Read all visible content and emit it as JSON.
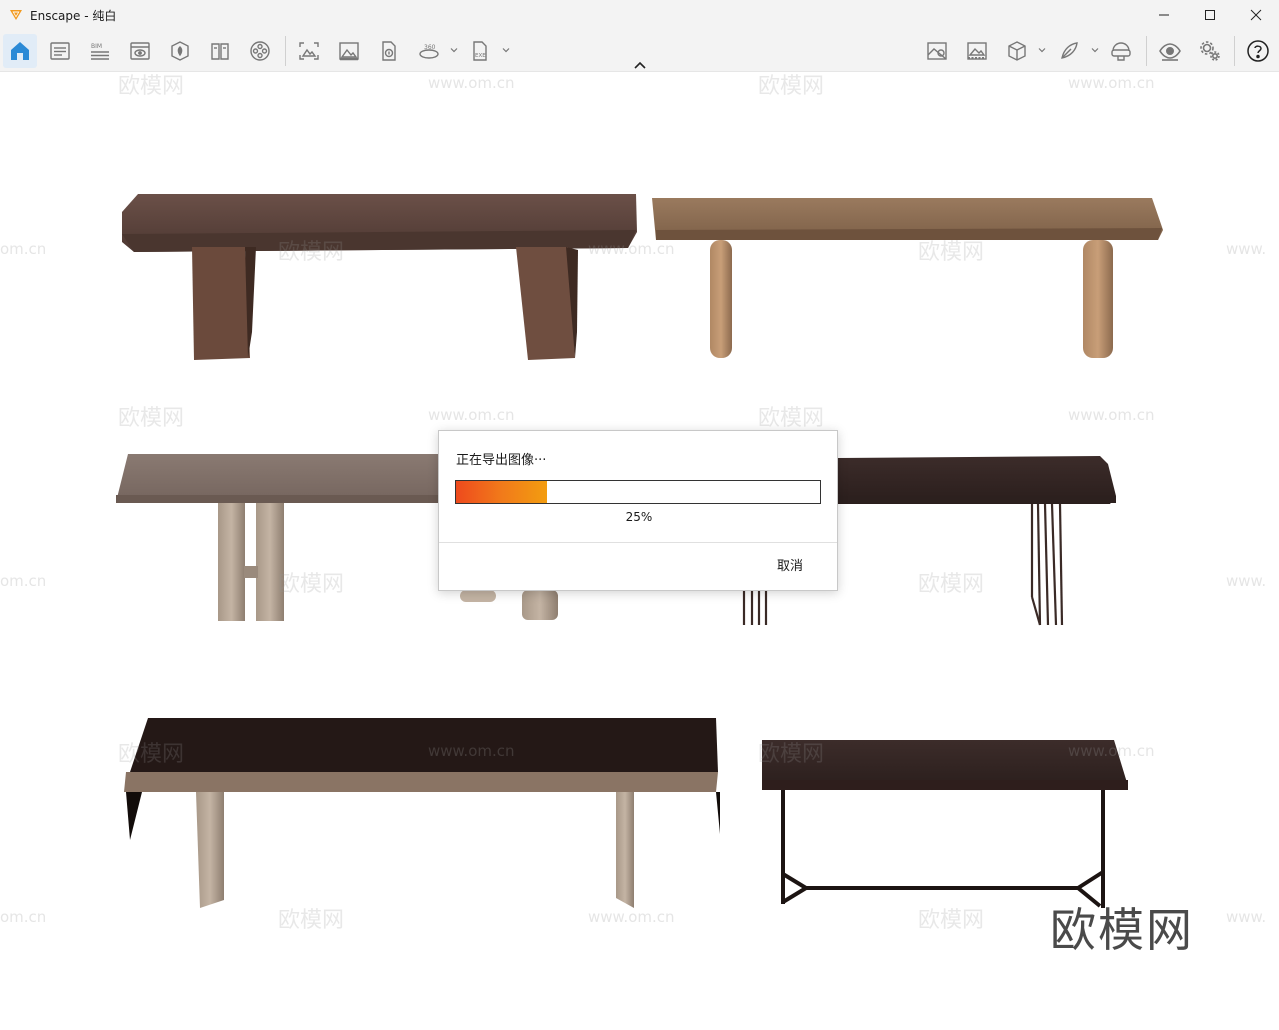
{
  "window": {
    "title": "Enscape - 纯白"
  },
  "toolbar": {
    "left_icons": [
      {
        "name": "home-icon",
        "active": true
      },
      {
        "name": "settings-list-icon"
      },
      {
        "name": "bim-icon",
        "label": "BIM"
      },
      {
        "name": "view-icon"
      },
      {
        "name": "asset-library-icon"
      },
      {
        "name": "material-book-icon"
      },
      {
        "name": "video-reel-icon"
      },
      {
        "name": "screenshot-icon"
      },
      {
        "name": "image-icon"
      },
      {
        "name": "upload-icon"
      },
      {
        "name": "panorama-360-icon",
        "label": "360"
      },
      {
        "name": "exe-export-icon",
        "label": "EXE"
      }
    ],
    "right_icons": [
      {
        "name": "map-icon"
      },
      {
        "name": "render-gallery-icon"
      },
      {
        "name": "cube-icon"
      },
      {
        "name": "feather-icon"
      },
      {
        "name": "vr-headset-icon"
      },
      {
        "name": "eye-icon"
      },
      {
        "name": "gears-icon"
      },
      {
        "name": "help-icon"
      }
    ]
  },
  "watermark": {
    "brand": "欧模网",
    "url": "www.om.cn",
    "url_fragment": "om.cn",
    "url_prefix": "www."
  },
  "brand_logo": "欧模网",
  "dialog": {
    "title": "正在导出图像···",
    "progress_percent": 25,
    "progress_label": "25%",
    "cancel_label": "取消"
  },
  "colors": {
    "accent": "#2b8ad6",
    "progress_start": "#ee4a1d",
    "progress_end": "#f39d10"
  }
}
